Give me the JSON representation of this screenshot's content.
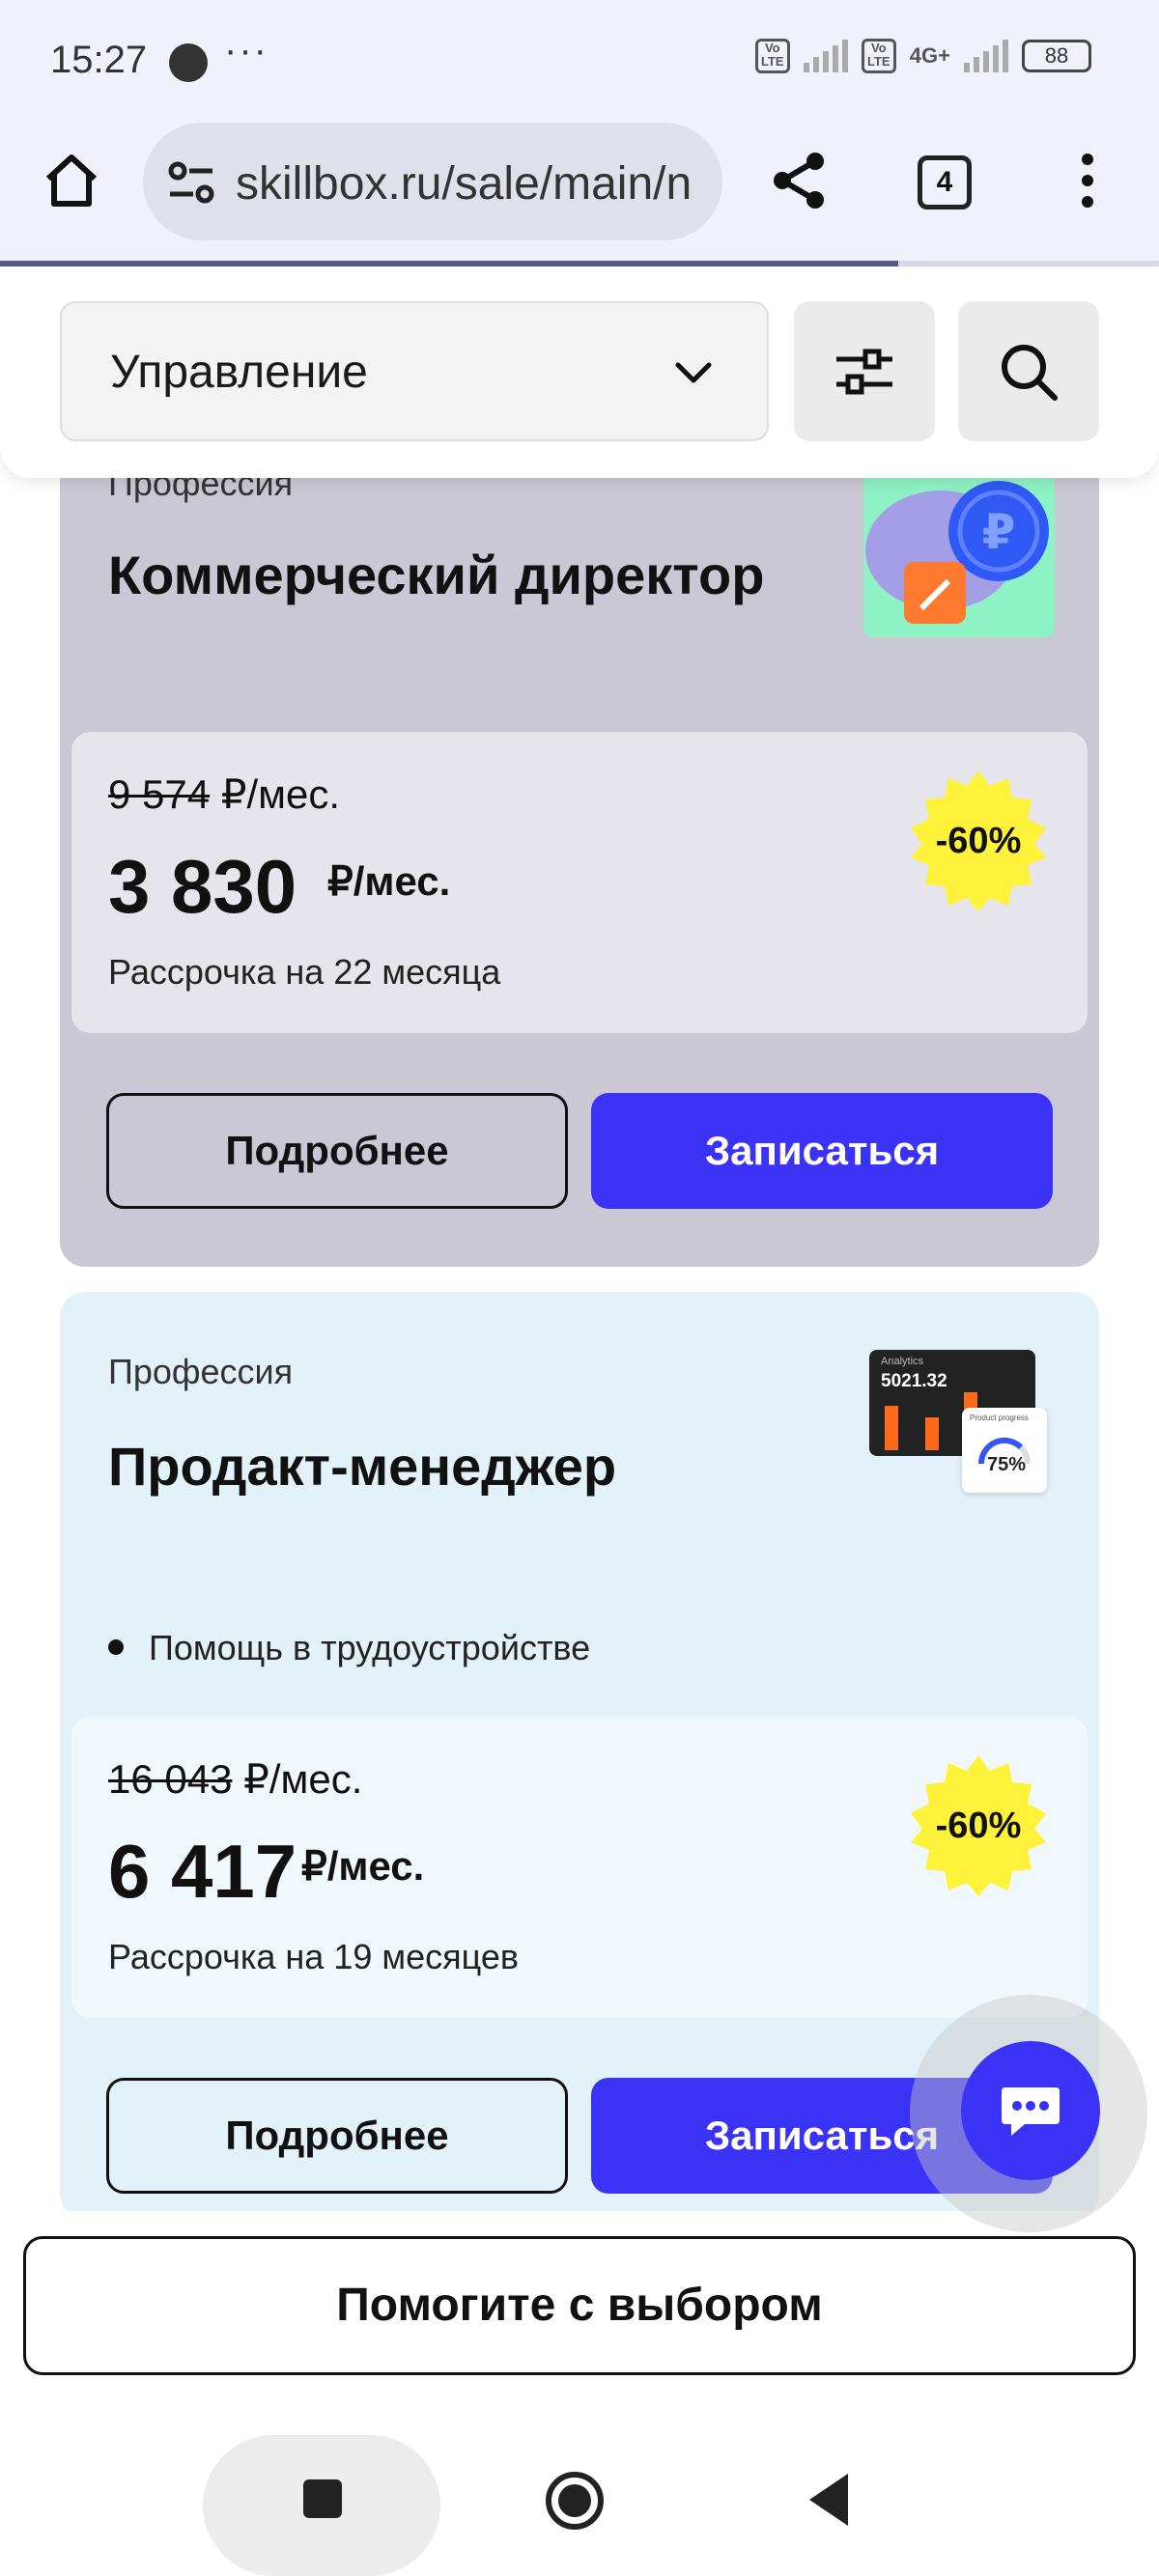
{
  "status_bar": {
    "time": "15:27",
    "more": "···",
    "volte_1": "Vo LTE",
    "volte_2": "Vo LTE",
    "network": "4G+",
    "battery": "88"
  },
  "browser": {
    "url": "skillbox.ru/sale/main/n",
    "tabs_count": "4",
    "home_icon": "home-icon",
    "site_settings_icon": "tune-icon",
    "share_icon": "share-icon",
    "menu_icon": "kebab-menu-icon",
    "load_progress": 0.775
  },
  "filters": {
    "select_value": "Управление",
    "filter_icon": "sliders-icon",
    "search_icon": "search-icon"
  },
  "cards": [
    {
      "kicker": "Профессия",
      "title": "Коммерческий директор",
      "old_price_num": "9 574",
      "old_price_unit": "₽/мес.",
      "new_price": "3 830",
      "new_price_unit": "₽/мес.",
      "installment": "Рассрочка на 22 месяца",
      "discount": "-60%",
      "details_label": "Подробнее",
      "enroll_label": "Записаться"
    },
    {
      "kicker": "Профессия",
      "title": "Продакт-менеджер",
      "feature": "Помощь в трудоустройстве",
      "thumb_caption": "Analytics",
      "thumb_value": "5021.32",
      "thumb_sub": "Product progress",
      "thumb_percent": "75%",
      "old_price_num": "16 043",
      "old_price_unit": "₽/мес.",
      "new_price": "6 417",
      "new_price_unit": "₽/мес.",
      "installment": "Рассрочка на 19 месяцев",
      "discount": "-60%",
      "details_label": "Подробнее",
      "enroll_label": "Записаться"
    }
  ],
  "help_button": "Помогите с выбором",
  "colors": {
    "accent": "#3a32f5",
    "badge": "#fff23a",
    "card1_bg": "#c9c8d4",
    "card2_bg": "#e3f1f8"
  }
}
